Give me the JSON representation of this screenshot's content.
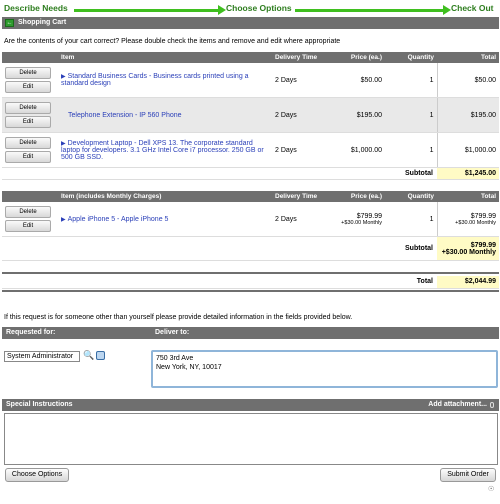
{
  "progress": {
    "steps": [
      "Describe Needs",
      "Choose Options",
      "Check Out"
    ]
  },
  "cart": {
    "title": "Shopping Cart",
    "prompt": "Are the contents of your cart correct? Please double check the items and remove and edit where appropriate",
    "columns": [
      "Item",
      "Delivery Time",
      "Price (ea.)",
      "Quantity",
      "Total"
    ],
    "items": [
      {
        "name": "Standard Business Cards - Business cards printed using a standard design",
        "delivery": "2 Days",
        "price": "$50.00",
        "qty": "1",
        "total": "$50.00"
      },
      {
        "name": "Telephone Extension - IP 560 Phone",
        "delivery": "2 Days",
        "price": "$195.00",
        "qty": "1",
        "total": "$195.00"
      },
      {
        "name": "Development Laptop - Dell XPS 13. The corporate standard laptop for developers. 3.1 GHz Intel Core i7 processor. 250 GB or 500 GB SSD.",
        "delivery": "2 Days",
        "price": "$1,000.00",
        "qty": "1",
        "total": "$1,000.00"
      }
    ],
    "subtotal_label": "Subtotal",
    "subtotal": "$1,245.00",
    "delete_label": "Delete",
    "edit_label": "Edit"
  },
  "monthly": {
    "columns": [
      "Item (includes Monthly Charges)",
      "Delivery Time",
      "Price (ea.)",
      "Quantity",
      "Total"
    ],
    "item": {
      "name": "Apple iPhone 5 - Apple iPhone 5",
      "delivery": "2 Days",
      "price": "$799.99",
      "price_monthly": "+$30.00 Monthly",
      "qty": "1",
      "total": "$799.99",
      "total_monthly": "+$30.00 Monthly"
    },
    "subtotal_label": "Subtotal",
    "subtotal": "$799.99",
    "subtotal_monthly": "+$30.00 Monthly"
  },
  "grand": {
    "label": "Total",
    "value": "$2,044.99"
  },
  "request": {
    "note": "If this request is for someone other than yourself please provide detailed information in the fields provided below.",
    "requested_for_label": "Requested for:",
    "deliver_to_label": "Deliver to:",
    "requested_for_value": "System Administrator",
    "address_line1": "750 3rd Ave",
    "address_line2": "New York, NY, 10017"
  },
  "instructions": {
    "label": "Special Instructions",
    "attach_label": "Add attachment..."
  },
  "buttons": {
    "choose_options": "Choose Options",
    "submit_order": "Submit Order"
  },
  "colors": {
    "progress_green": "#3fbf1f",
    "header_gray": "#6f6f6f",
    "link_blue": "#2a3fb8",
    "total_yellow": "#fffbc5"
  }
}
